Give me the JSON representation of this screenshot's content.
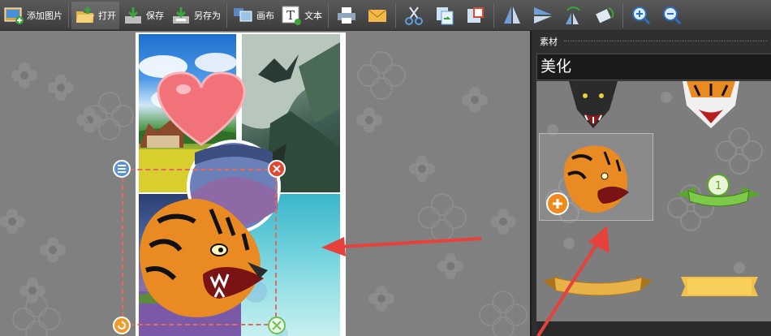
{
  "toolbar": {
    "add_image_label": "添加图片",
    "open_label": "打开",
    "save_label": "保存",
    "save_as_label": "另存为",
    "canvas_label": "画布",
    "text_label": "文本",
    "icons": [
      "add-image-icon",
      "open-folder-icon",
      "save-icon",
      "save-as-icon",
      "canvas-icon",
      "text-icon",
      "print-icon",
      "mail-icon",
      "cut-icon",
      "copy-icon",
      "paste-icon",
      "flip-vertical-icon",
      "flip-horizontal-icon",
      "rotate-left-icon",
      "rotate-right-icon",
      "zoom-in-icon",
      "zoom-out-icon"
    ]
  },
  "panel": {
    "title": "素材",
    "category": "美化",
    "items": [
      "wolf-sticker",
      "tiger-sticker",
      "tiger-head-sticker",
      "number-one-ribbon",
      "gold-ribbon",
      "yellow-banner"
    ]
  },
  "colors": {
    "toolbar_bg": "#3c3c3c",
    "canvas_bg": "#808080",
    "panel_bg": "#2f2f2f",
    "selection": "#e36a5c",
    "arrow": "#e8413c",
    "add_badge": "#f08a1c"
  }
}
